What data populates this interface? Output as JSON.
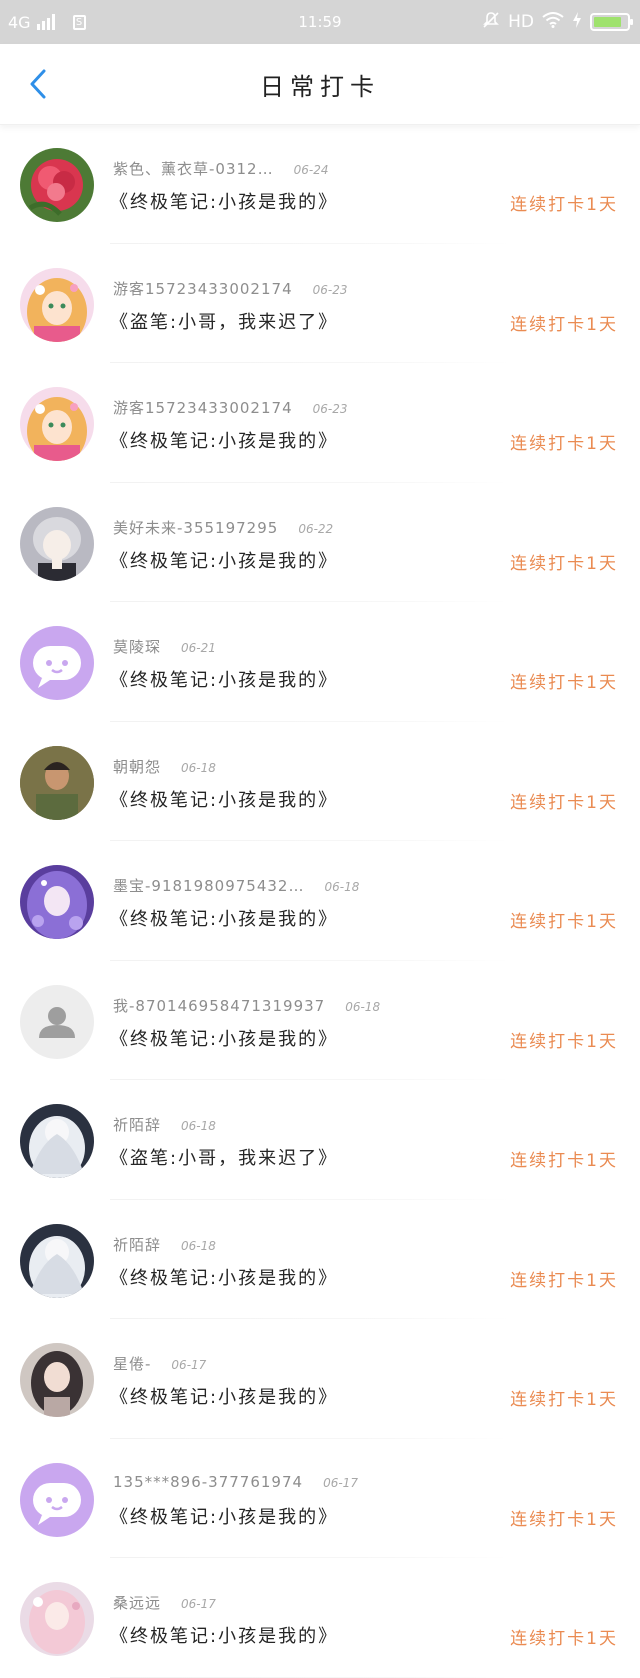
{
  "status_bar": {
    "network": "4G",
    "time": "11:59",
    "hd_label": "HD",
    "battery_level": 0.85,
    "battery_color": "#9fe26d"
  },
  "header": {
    "title": "日常打卡",
    "back_icon": "chevron-left-icon",
    "accent_color": "#2f8fe8"
  },
  "list": {
    "items": [
      {
        "user": "紫色、薰衣草-0312…",
        "date": "06-24",
        "book": "《终极笔记:小孩是我的》",
        "streak": "连续打卡1天",
        "avatar": "pink-flower"
      },
      {
        "user": "游客15723433002174",
        "date": "06-23",
        "book": "《盗笔:小哥，我来迟了》",
        "streak": "连续打卡1天",
        "avatar": "anime-girl-blonde"
      },
      {
        "user": "游客15723433002174",
        "date": "06-23",
        "book": "《终极笔记:小孩是我的》",
        "streak": "连续打卡1天",
        "avatar": "anime-girl-blonde"
      },
      {
        "user": "美好未来-355197295",
        "date": "06-22",
        "book": "《终极笔记:小孩是我的》",
        "streak": "连续打卡1天",
        "avatar": "anime-boy-silver"
      },
      {
        "user": "莫陵琛",
        "date": "06-21",
        "book": "《终极笔记:小孩是我的》",
        "streak": "连续打卡1天",
        "avatar": "default-chat-purple"
      },
      {
        "user": "朝朝怨",
        "date": "06-18",
        "book": "《终极笔记:小孩是我的》",
        "streak": "连续打卡1天",
        "avatar": "photo-man-outdoor"
      },
      {
        "user": "墨宝-9181980975432…",
        "date": "06-18",
        "book": "《终极笔记:小孩是我的》",
        "streak": "连续打卡1天",
        "avatar": "anime-girl-purple"
      },
      {
        "user": "我-870146958471319937",
        "date": "06-18",
        "book": "《终极笔记:小孩是我的》",
        "streak": "连续打卡1天",
        "avatar": "default-person-gray"
      },
      {
        "user": "祈陌辞",
        "date": "06-18",
        "book": "《盗笔:小哥，我来迟了》",
        "streak": "连续打卡1天",
        "avatar": "white-hair-figure"
      },
      {
        "user": "祈陌辞",
        "date": "06-18",
        "book": "《终极笔记:小孩是我的》",
        "streak": "连续打卡1天",
        "avatar": "white-hair-figure"
      },
      {
        "user": "星倦-",
        "date": "06-17",
        "book": "《终极笔记:小孩是我的》",
        "streak": "连续打卡1天",
        "avatar": "dark-hair-girl"
      },
      {
        "user": "135***896-377761974",
        "date": "06-17",
        "book": "《终极笔记:小孩是我的》",
        "streak": "连续打卡1天",
        "avatar": "default-chat-purple"
      },
      {
        "user": "桑远远",
        "date": "06-17",
        "book": "《终极笔记:小孩是我的》",
        "streak": "连续打卡1天",
        "avatar": "pastel-girl-pink"
      }
    ]
  },
  "colors": {
    "streak": "#ea8b52",
    "username": "#8d8d8d",
    "date": "#a8a8a8",
    "book_title": "#262626",
    "status_bar_bg": "#d5d5d5"
  }
}
